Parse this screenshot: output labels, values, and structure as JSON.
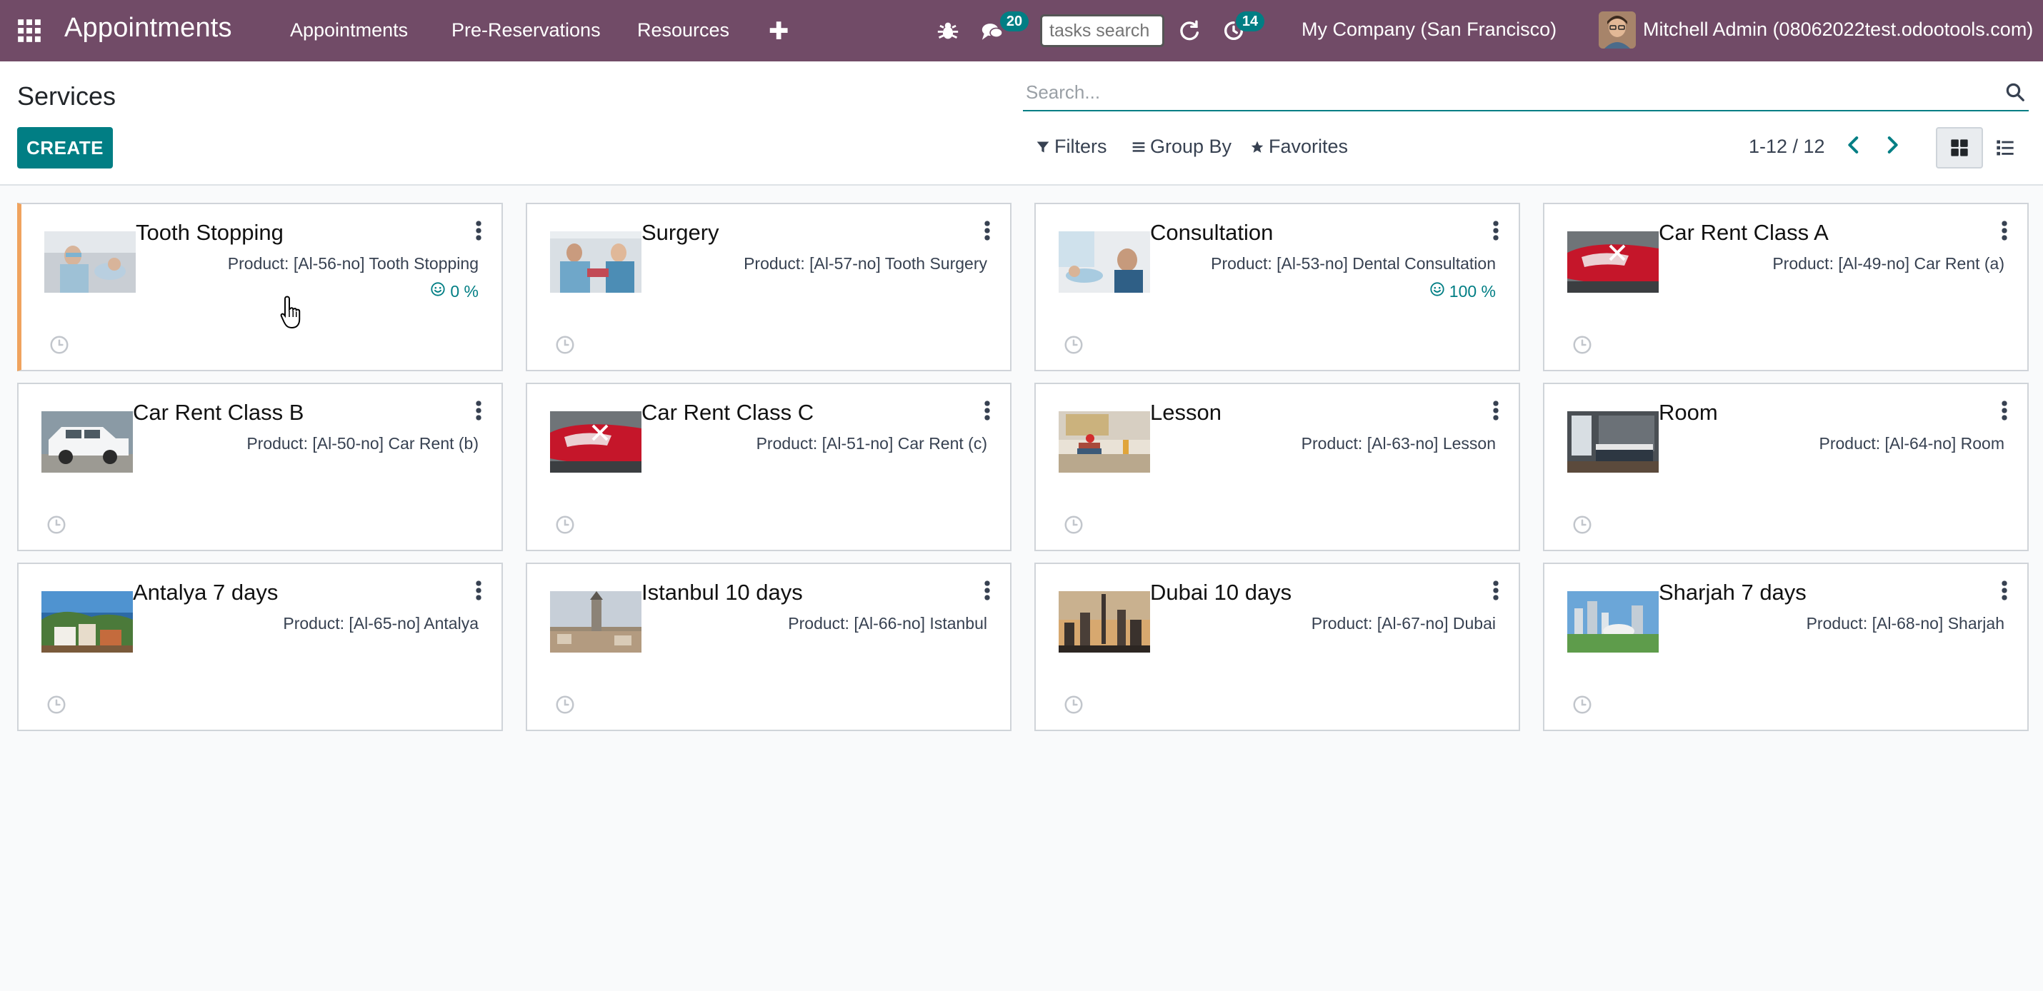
{
  "topbar": {
    "app_title": "Appointments",
    "menu": [
      "Appointments",
      "Pre-Reservations",
      "Resources"
    ],
    "messages_badge": "20",
    "activities_badge": "14",
    "tasks_search_placeholder": "tasks search",
    "company": "My Company (San Francisco)",
    "user": "Mitchell Admin (08062022test.odootools.com)"
  },
  "control_panel": {
    "title": "Services",
    "create_label": "CREATE",
    "search_placeholder": "Search...",
    "filters_label": "Filters",
    "groupby_label": "Group By",
    "favorites_label": "Favorites",
    "pager": "1-12 / 12"
  },
  "cards": [
    {
      "title": "Tooth Stopping",
      "product": "Product: [Al-56-no] Tooth Stopping",
      "rating": "0 %",
      "image": "dentist-patient-photo"
    },
    {
      "title": "Surgery",
      "product": "Product: [Al-57-no] Tooth Surgery",
      "rating": "",
      "image": "dental-surgery-photo"
    },
    {
      "title": "Consultation",
      "product": "Product: [Al-53-no] Dental Consultation",
      "rating": "100 %",
      "image": "dental-consultation-photo"
    },
    {
      "title": "Car Rent Class A",
      "product": "Product: [Al-49-no] Car Rent (a)",
      "rating": "",
      "image": "red-car-photo"
    },
    {
      "title": "Car Rent Class B",
      "product": "Product: [Al-50-no] Car Rent (b)",
      "rating": "",
      "image": "white-suv-photo"
    },
    {
      "title": "Car Rent Class C",
      "product": "Product: [Al-51-no] Car Rent (c)",
      "rating": "",
      "image": "red-car-photo"
    },
    {
      "title": "Lesson",
      "product": "Product: [Al-63-no] Lesson",
      "rating": "",
      "image": "desk-books-photo"
    },
    {
      "title": "Room",
      "product": "Product: [Al-64-no] Room",
      "rating": "",
      "image": "bedroom-photo"
    },
    {
      "title": "Antalya 7 days",
      "product": "Product: [Al-65-no] Antalya",
      "rating": "",
      "image": "coastal-town-photo"
    },
    {
      "title": "Istanbul 10 days",
      "product": "Product: [Al-66-no] Istanbul",
      "rating": "",
      "image": "istanbul-city-photo"
    },
    {
      "title": "Dubai 10 days",
      "product": "Product: [Al-67-no] Dubai",
      "rating": "",
      "image": "dubai-skyline-photo"
    },
    {
      "title": "Sharjah 7 days",
      "product": "Product: [Al-68-no] Sharjah",
      "rating": "",
      "image": "sharjah-skyline-photo"
    }
  ],
  "colors": {
    "brand": "#714b67",
    "primary": "#017e84",
    "accent_stripe": "#f0a35e"
  }
}
